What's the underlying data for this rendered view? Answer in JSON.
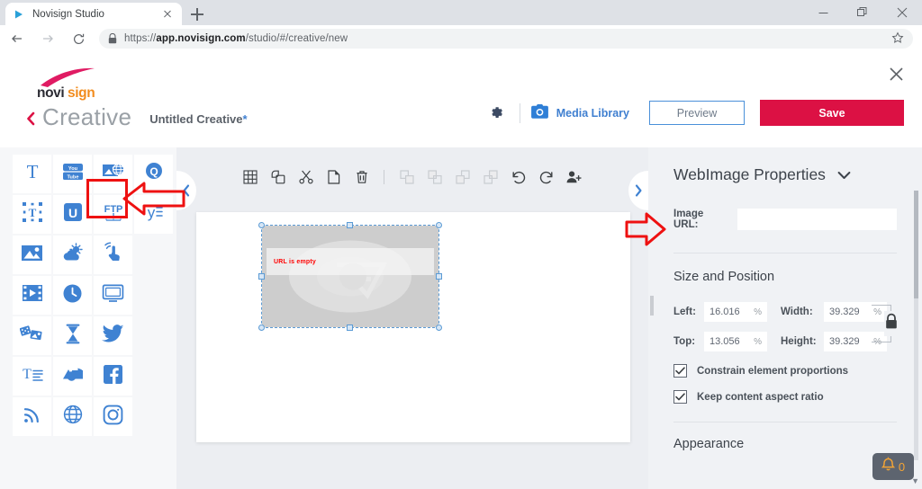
{
  "browser": {
    "tab": {
      "title": "Novisign Studio",
      "favicon": "play-icon"
    },
    "new_tab_label": "+",
    "url_prefix": "https://",
    "url_host": "app.novisign.com",
    "url_path": "/studio/#/creative/new",
    "window_controls": [
      "minimize",
      "restore",
      "close"
    ]
  },
  "app": {
    "logo": {
      "text_dark": "novi",
      "text_accent": "sign",
      "accent_color": "#f28c1e",
      "swoosh_color": "#e01b63"
    },
    "breadcrumb": {
      "back_label": "back",
      "section": "Creative",
      "document_name": "Untitled Creative",
      "dirty_marker": "*"
    },
    "header_actions": {
      "settings_label": "settings",
      "media_library_label": "Media Library",
      "preview_label": "Preview",
      "save_label": "Save",
      "close_label": "close"
    },
    "accent_blue": "#3f82d2",
    "brand_red": "#dc1144"
  },
  "palette": {
    "items": [
      {
        "name": "text-widget",
        "glyph": "T"
      },
      {
        "name": "youtube-widget",
        "glyph": "youtube"
      },
      {
        "name": "web-image-widget",
        "glyph": "web-image",
        "highlighted": true
      },
      {
        "name": "search-widget",
        "glyph": "search-q"
      },
      {
        "name": "rich-text-widget",
        "glyph": "rich-text"
      },
      {
        "name": "unsplash-widget",
        "glyph": "U"
      },
      {
        "name": "ftp-widget",
        "glyph": "FTP"
      },
      {
        "name": "yahoo-widget",
        "glyph": "y"
      },
      {
        "name": "image-widget",
        "glyph": "image"
      },
      {
        "name": "weather-widget",
        "glyph": "weather"
      },
      {
        "name": "touch-widget",
        "glyph": "touch"
      },
      {
        "name": "empty-slot",
        "glyph": ""
      },
      {
        "name": "video-widget",
        "glyph": "film"
      },
      {
        "name": "clock-widget",
        "glyph": "clock"
      },
      {
        "name": "screen-widget",
        "glyph": "monitor"
      },
      {
        "name": "empty-slot",
        "glyph": ""
      },
      {
        "name": "slideshow-widget",
        "glyph": "cards"
      },
      {
        "name": "countdown-widget",
        "glyph": "hourglass"
      },
      {
        "name": "twitter-widget",
        "glyph": "twitter"
      },
      {
        "name": "empty-slot",
        "glyph": ""
      },
      {
        "name": "text-list-widget",
        "glyph": "text-list"
      },
      {
        "name": "gallery-widget",
        "glyph": "gallery"
      },
      {
        "name": "facebook-widget",
        "glyph": "facebook"
      },
      {
        "name": "empty-slot",
        "glyph": ""
      },
      {
        "name": "rss-widget",
        "glyph": "rss"
      },
      {
        "name": "web-page-widget",
        "glyph": "globe"
      },
      {
        "name": "instagram-widget",
        "glyph": "instagram"
      },
      {
        "name": "empty-slot",
        "glyph": ""
      }
    ]
  },
  "canvas": {
    "toolbar": [
      {
        "name": "grid-icon",
        "enabled": true
      },
      {
        "name": "duplicate-icon",
        "enabled": true
      },
      {
        "name": "cut-icon",
        "enabled": true
      },
      {
        "name": "paste-icon",
        "enabled": true
      },
      {
        "name": "delete-icon",
        "enabled": true
      },
      {
        "name": "bring-to-front-icon",
        "enabled": false
      },
      {
        "name": "bring-forward-icon",
        "enabled": false
      },
      {
        "name": "send-backward-icon",
        "enabled": false
      },
      {
        "name": "send-to-back-icon",
        "enabled": false
      },
      {
        "name": "undo-icon",
        "enabled": true
      },
      {
        "name": "redo-icon",
        "enabled": true
      },
      {
        "name": "add-user-icon",
        "enabled": true
      }
    ],
    "selected_element": {
      "error_text": "URL is empty"
    },
    "collapse_left_label": "‹",
    "collapse_right_label": "›"
  },
  "properties": {
    "title": "WebImage Properties",
    "image_url": {
      "label": "Image URL:",
      "value": "",
      "placeholder": ""
    },
    "size_section_title": "Size and Position",
    "fields": [
      {
        "label": "Left:",
        "value": "16.016",
        "unit": "%"
      },
      {
        "label": "Width:",
        "value": "39.329",
        "unit": "%"
      },
      {
        "label": "Top:",
        "value": "13.056",
        "unit": "%"
      },
      {
        "label": "Height:",
        "value": "39.329",
        "unit": "%"
      }
    ],
    "lock_label": "aspect-lock",
    "checkboxes": [
      {
        "label": "Constrain element proportions",
        "checked": true
      },
      {
        "label": "Keep content aspect ratio",
        "checked": true
      }
    ],
    "appearance_title": "Appearance"
  },
  "notifications": {
    "count": "0",
    "icon": "bell-icon",
    "color": "#f3a435"
  }
}
